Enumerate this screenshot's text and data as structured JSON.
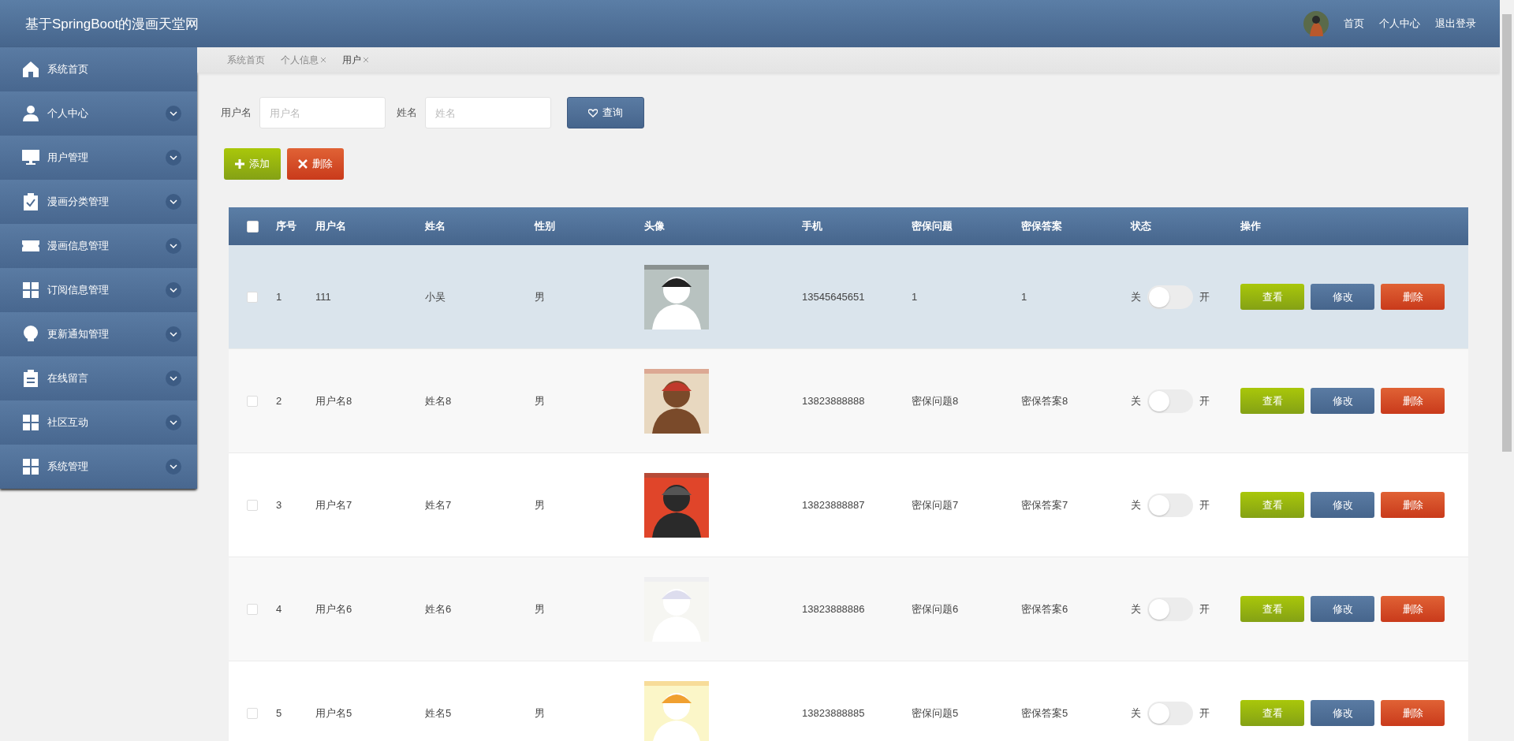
{
  "header": {
    "title": "基于SpringBoot的漫画天堂网",
    "nav": [
      "首页",
      "个人中心",
      "退出登录"
    ]
  },
  "sidebar": {
    "items": [
      {
        "label": "系统首页",
        "expandable": false
      },
      {
        "label": "个人中心",
        "expandable": true
      },
      {
        "label": "用户管理",
        "expandable": true
      },
      {
        "label": "漫画分类管理",
        "expandable": true
      },
      {
        "label": "漫画信息管理",
        "expandable": true
      },
      {
        "label": "订阅信息管理",
        "expandable": true
      },
      {
        "label": "更新通知管理",
        "expandable": true
      },
      {
        "label": "在线留言",
        "expandable": true
      },
      {
        "label": "社区互动",
        "expandable": true
      },
      {
        "label": "系统管理",
        "expandable": true
      }
    ]
  },
  "breadcrumbs": [
    {
      "label": "系统首页",
      "closable": false,
      "selected": false
    },
    {
      "label": "个人信息",
      "closable": true,
      "selected": false
    },
    {
      "label": "用户",
      "closable": true,
      "selected": true
    }
  ],
  "search": {
    "fields": [
      {
        "label": "用户名",
        "placeholder": "用户名"
      },
      {
        "label": "姓名",
        "placeholder": "姓名"
      }
    ],
    "button": "查询"
  },
  "actions": [
    {
      "kind": "add",
      "label": "添加"
    },
    {
      "kind": "delete",
      "label": "删除"
    }
  ],
  "table": {
    "columns": [
      "序号",
      "用户名",
      "姓名",
      "性别",
      "头像",
      "手机",
      "密保问题",
      "密保答案",
      "状态",
      "操作"
    ],
    "all_checked": false,
    "rows": [
      {
        "selected": true,
        "checked": false,
        "cells": [
          "1",
          "111",
          "小吴",
          "男",
          {
            "kind": "picture"
          },
          "13545645651",
          "1",
          "1"
        ],
        "switch": {
          "off_label": "关",
          "on_label": "开",
          "on": false
        },
        "buttons": [
          {
            "kind": "view",
            "label": "查看"
          },
          {
            "kind": "edit",
            "label": "修改"
          },
          {
            "kind": "delete",
            "label": "删除"
          }
        ]
      },
      {
        "selected": false,
        "checked": false,
        "cells": [
          "2",
          "用户名8",
          "姓名8",
          "男",
          {
            "kind": "picture"
          },
          "13823888888",
          "密保问题8",
          "密保答案8"
        ],
        "switch": {
          "off_label": "关",
          "on_label": "开",
          "on": false
        },
        "buttons": [
          {
            "kind": "view",
            "label": "查看"
          },
          {
            "kind": "edit",
            "label": "修改"
          },
          {
            "kind": "delete",
            "label": "删除"
          }
        ]
      },
      {
        "selected": false,
        "checked": false,
        "cells": [
          "3",
          "用户名7",
          "姓名7",
          "男",
          {
            "kind": "picture"
          },
          "13823888887",
          "密保问题7",
          "密保答案7"
        ],
        "switch": {
          "off_label": "关",
          "on_label": "开",
          "on": false
        },
        "buttons": [
          {
            "kind": "view",
            "label": "查看"
          },
          {
            "kind": "edit",
            "label": "修改"
          },
          {
            "kind": "delete",
            "label": "删除"
          }
        ]
      },
      {
        "selected": false,
        "checked": false,
        "cells": [
          "4",
          "用户名6",
          "姓名6",
          "男",
          {
            "kind": "picture"
          },
          "13823888886",
          "密保问题6",
          "密保答案6"
        ],
        "switch": {
          "off_label": "关",
          "on_label": "开",
          "on": false
        },
        "buttons": [
          {
            "kind": "view",
            "label": "查看"
          },
          {
            "kind": "edit",
            "label": "修改"
          },
          {
            "kind": "delete",
            "label": "删除"
          }
        ]
      },
      {
        "selected": false,
        "checked": false,
        "cells": [
          "5",
          "用户名5",
          "姓名5",
          "男",
          {
            "kind": "picture"
          },
          "13823888885",
          "密保问题5",
          "密保答案5"
        ],
        "switch": {
          "off_label": "关",
          "on_label": "开",
          "on": false
        },
        "buttons": [
          {
            "kind": "view",
            "label": "查看"
          },
          {
            "kind": "edit",
            "label": "修改"
          },
          {
            "kind": "delete",
            "label": "删除"
          }
        ]
      }
    ]
  }
}
